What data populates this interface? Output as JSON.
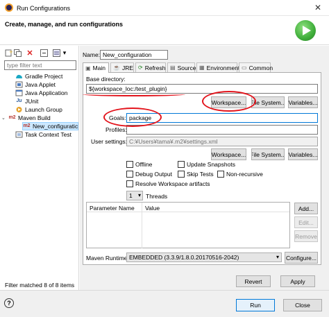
{
  "window": {
    "title": "Run Configurations",
    "close_glyph": "✕"
  },
  "header": {
    "heading": "Create, manage, and run configurations"
  },
  "toolbar": {
    "dropdown_glyph": "▾"
  },
  "left": {
    "filter_placeholder": "type filter text",
    "tree": [
      {
        "label": "Gradle Project",
        "icon": "gradle-icon"
      },
      {
        "label": "Java Applet",
        "icon": "applet-icon"
      },
      {
        "label": "Java Application",
        "icon": "java-app-icon"
      },
      {
        "label": "JUnit",
        "icon": "junit-icon",
        "icon_text": "Ju"
      },
      {
        "label": "Launch Group",
        "icon": "launch-group-icon"
      },
      {
        "label": "Maven Build",
        "icon": "maven-icon",
        "icon_text": "m2"
      },
      {
        "label": "New_configuratic",
        "icon": "maven-icon",
        "icon_text": "m2"
      },
      {
        "label": "Task Context Test",
        "icon": "task-context-icon"
      }
    ],
    "status": "Filter matched 8 of 8 items"
  },
  "config": {
    "name_label": "Name:",
    "name_value": "New_configuration",
    "tabs": [
      {
        "label": "Main",
        "icon": "main-tab-icon",
        "glyph": "▣"
      },
      {
        "label": "JRE",
        "icon": "jre-tab-icon",
        "glyph": "☕"
      },
      {
        "label": "Refresh",
        "icon": "refresh-tab-icon",
        "glyph": "⟳"
      },
      {
        "label": "Source",
        "icon": "source-tab-icon",
        "glyph": "▤"
      },
      {
        "label": "Environment",
        "icon": "environment-tab-icon",
        "glyph": "▦"
      },
      {
        "label": "Common",
        "icon": "common-tab-icon",
        "glyph": "▭"
      }
    ],
    "basedir_label": "Base directory:",
    "basedir_value": "${workspace_loc:/test_plugin}",
    "workspace_button": "Workspace...",
    "filesystem_button": "File System...",
    "variables_button": "Variables...",
    "goals_label": "Goals:",
    "goals_value": "package",
    "profiles_label": "Profiles:",
    "profiles_value": "",
    "user_settings_label": "User settings:",
    "user_settings_value": "C:¥Users¥tama¥.m2¥settings.xml",
    "checkboxes": {
      "offline": "Offline",
      "update_snapshots": "Update Snapshots",
      "debug_output": "Debug Output",
      "skip_tests": "Skip Tests",
      "non_recursive": "Non-recursive",
      "resolve_workspace": "Resolve Workspace artifacts"
    },
    "threads_value": "1",
    "threads_label": "Threads",
    "table_headers": [
      "Parameter Name",
      "Value"
    ],
    "add_button": "Add...",
    "edit_button": "Edit...",
    "remove_button": "Remove",
    "runtime_label": "Maven Runtime:",
    "runtime_value": "EMBEDDED (3.3.9/1.8.0.20170516-2042)",
    "configure_button": "Configure...",
    "revert_button": "Revert",
    "apply_button": "Apply"
  },
  "footer": {
    "help_glyph": "?",
    "run_button": "Run",
    "close_button": "Close"
  },
  "colors": {
    "annotation": "#e3141c",
    "run_icon": "#3fae3a",
    "maven_icon": "#b5322c"
  }
}
